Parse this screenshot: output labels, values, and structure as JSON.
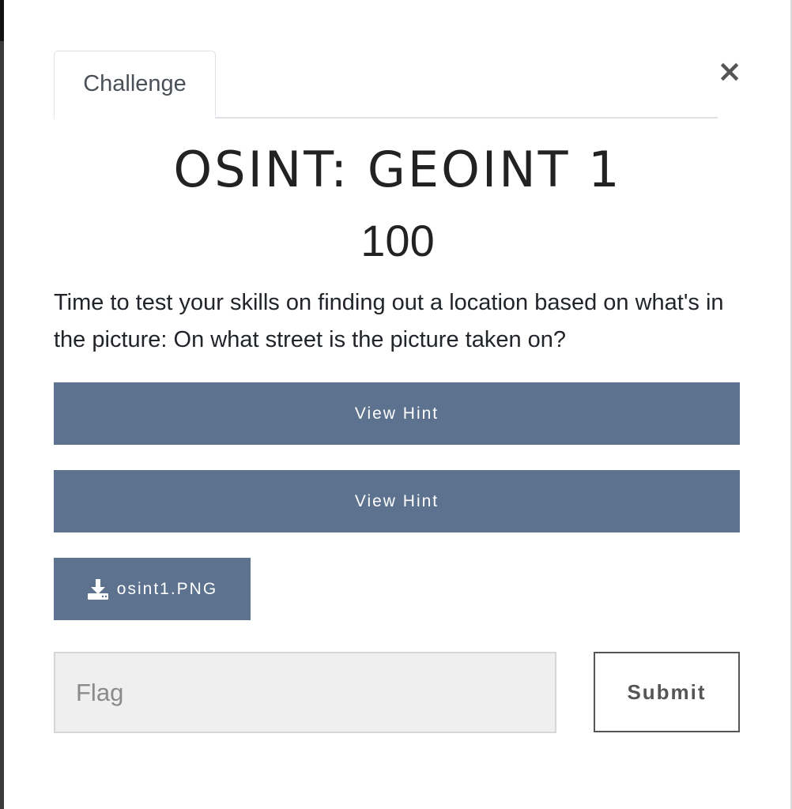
{
  "modal": {
    "tab_label": "Challenge",
    "close_glyph": "×"
  },
  "challenge": {
    "name": "OSINT: GEOINT 1",
    "points": "100",
    "description": "Time to test your skills on finding out a location based on what's in the picture: On what street is the picture taken on?"
  },
  "hints": [
    {
      "label": "View Hint"
    },
    {
      "label": "View Hint"
    }
  ],
  "files": [
    {
      "name": "osint1.PNG",
      "icon": "download-icon"
    }
  ],
  "submission": {
    "placeholder": "Flag",
    "value": "",
    "submit_label": "Submit"
  },
  "colors": {
    "button_bg": "#5c728f",
    "input_bg": "#efefef"
  }
}
